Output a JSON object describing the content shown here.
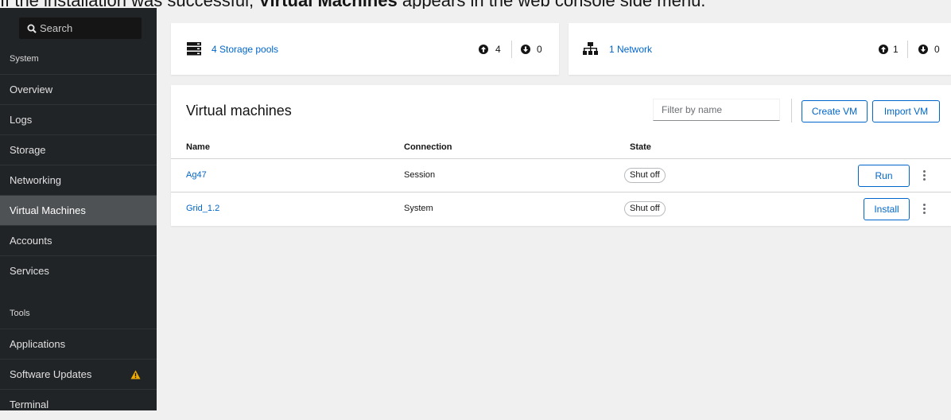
{
  "caption": {
    "prefix": "If the installation was successful,",
    "bold": "Virtual Machines",
    "suffix": "appears in the web console side menu."
  },
  "sidebar": {
    "search_placeholder": "Search",
    "sections": {
      "system": "System",
      "tools": "Tools"
    },
    "system_items": [
      {
        "label": "Overview"
      },
      {
        "label": "Logs"
      },
      {
        "label": "Storage"
      },
      {
        "label": "Networking"
      },
      {
        "label": "Virtual Machines",
        "active": true
      },
      {
        "label": "Accounts"
      },
      {
        "label": "Services"
      }
    ],
    "tool_items": [
      {
        "label": "Applications"
      },
      {
        "label": "Software Updates",
        "warning": true
      },
      {
        "label": "Terminal"
      }
    ]
  },
  "storage_card": {
    "link": "4 Storage pools",
    "up_count": "4",
    "down_count": "0"
  },
  "network_card": {
    "link": "1 Network",
    "up_count": "1",
    "down_count": "0"
  },
  "vm_panel": {
    "title": "Virtual machines",
    "filter_placeholder": "Filter by name",
    "create_button": "Create VM",
    "import_button": "Import VM",
    "columns": {
      "name": "Name",
      "connection": "Connection",
      "state": "State"
    },
    "rows": [
      {
        "name": "Ag47",
        "connection": "Session",
        "state": "Shut off",
        "action": "Run"
      },
      {
        "name": "Grid_1.2",
        "connection": "System",
        "state": "Shut off",
        "action": "Install"
      }
    ]
  },
  "colors": {
    "accent": "#0066cc",
    "sidebar_bg": "#212427",
    "sidebar_active": "#4f5255",
    "warning": "#f0ab00"
  }
}
